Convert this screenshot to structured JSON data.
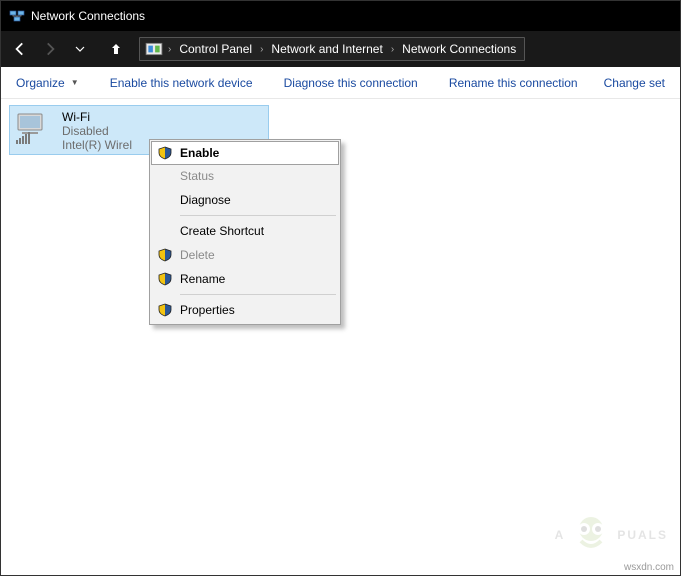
{
  "title": "Network Connections",
  "breadcrumb": {
    "items": [
      "Control Panel",
      "Network and Internet",
      "Network Connections"
    ]
  },
  "commands": {
    "organize": "Organize",
    "enable": "Enable this network device",
    "diagnose": "Diagnose this connection",
    "rename": "Rename this connection",
    "change": "Change set"
  },
  "adapter": {
    "name": "Wi-Fi",
    "status": "Disabled",
    "desc": "Intel(R) Wirel"
  },
  "context_menu": {
    "enable": "Enable",
    "status": "Status",
    "diagnose": "Diagnose",
    "shortcut": "Create Shortcut",
    "delete": "Delete",
    "rename": "Rename",
    "properties": "Properties"
  },
  "watermark": {
    "left": "A",
    "right": "PUALS"
  },
  "site": "wsxdn.com"
}
